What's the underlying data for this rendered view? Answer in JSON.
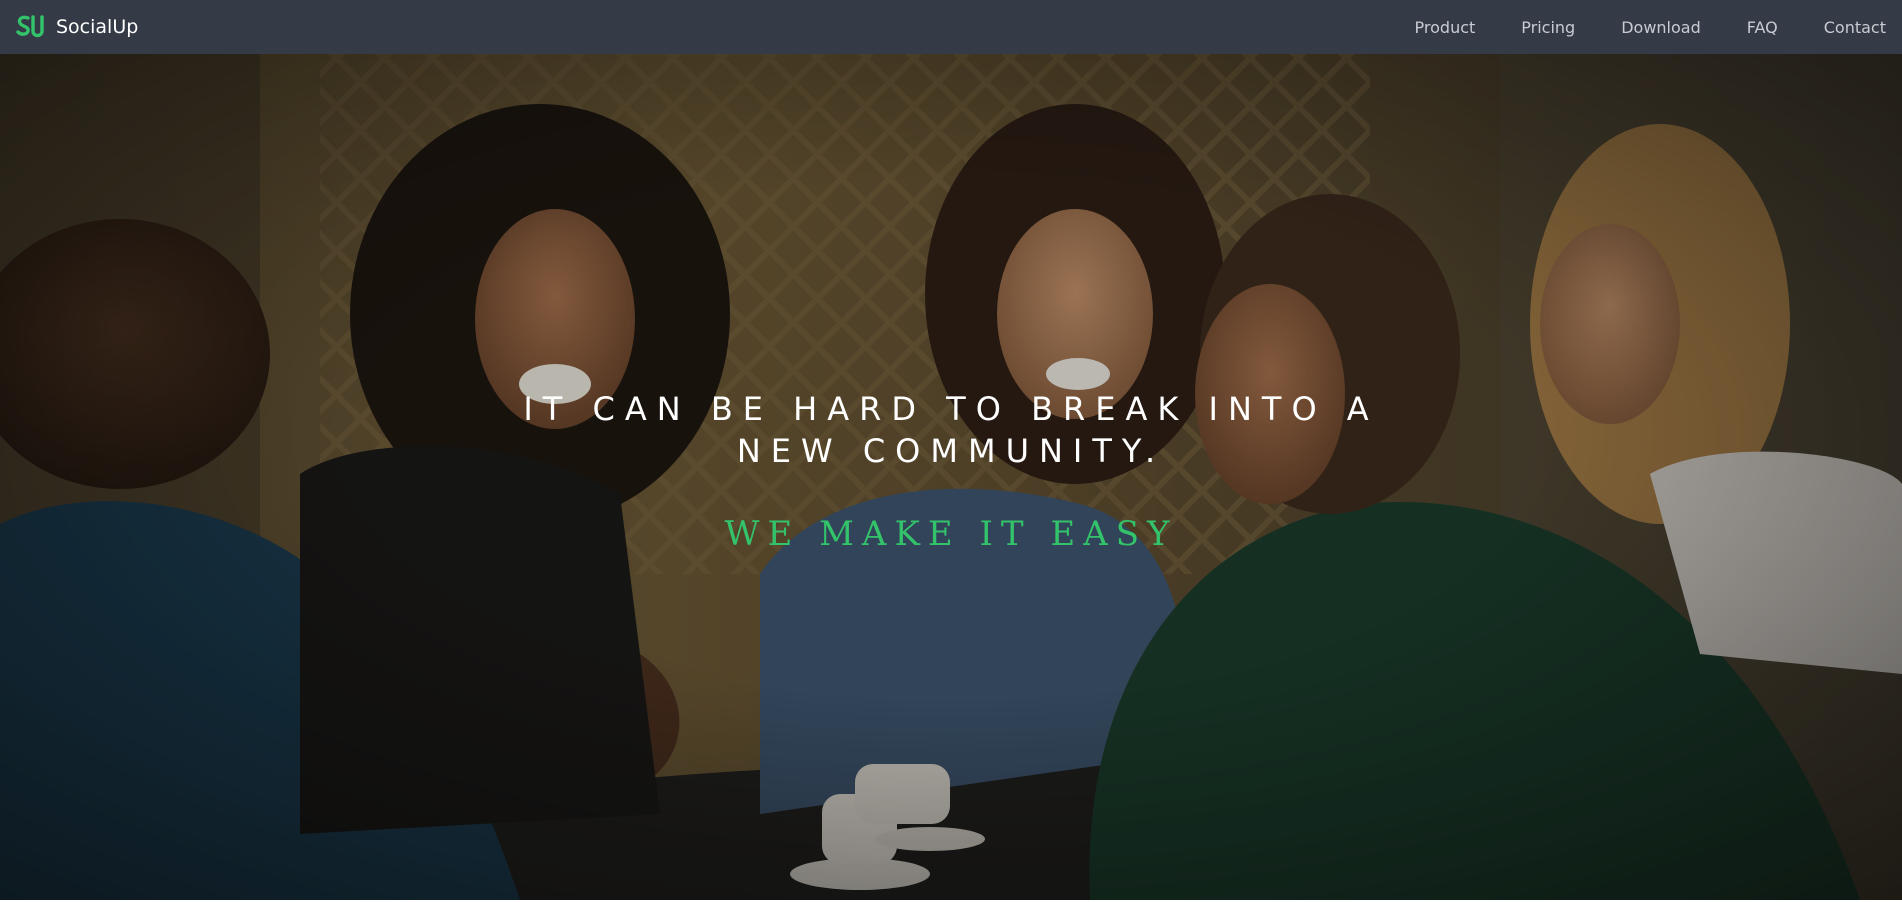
{
  "brand": {
    "name": "SocialUp",
    "logo_icon": "su-logo-icon",
    "accent_color": "#33c46b"
  },
  "nav": {
    "items": [
      {
        "label": "Product"
      },
      {
        "label": "Pricing"
      },
      {
        "label": "Download"
      },
      {
        "label": "FAQ"
      },
      {
        "label": "Contact"
      }
    ]
  },
  "hero": {
    "headline": "IT CAN BE HARD TO BREAK INTO A NEW COMMUNITY.",
    "tagline": "WE MAKE IT EASY",
    "background_image": "group-of-friends-laughing-at-cafe-table"
  }
}
